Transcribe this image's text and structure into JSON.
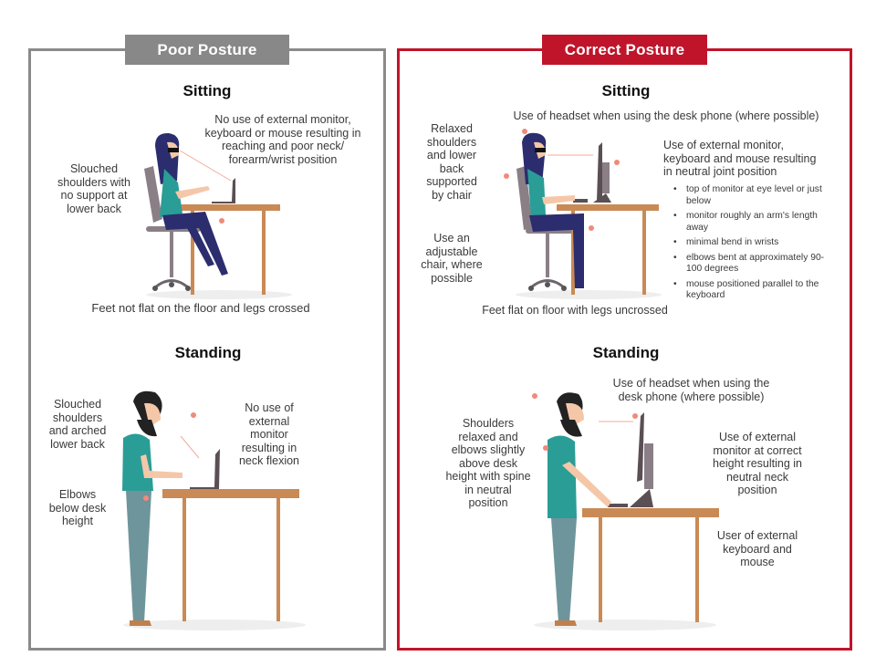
{
  "poor": {
    "badge": "Poor Posture",
    "sitting": {
      "heading": "Sitting",
      "notes": {
        "slouched": "Slouched\nshoulders with\nno support at\nlower back",
        "no_monitor": "No use of external monitor,\nkeyboard or mouse resulting in\nreaching and poor neck/\nforearm/wrist position",
        "feet": "Feet not flat on the floor and legs crossed"
      }
    },
    "standing": {
      "heading": "Standing",
      "notes": {
        "slouched": "Slouched\nshoulders\nand arched\nlower back",
        "elbows": "Elbows\nbelow desk\nheight",
        "no_monitor": "No use of\nexternal\nmonitor\nresulting in\nneck flexion"
      }
    }
  },
  "correct": {
    "badge": "Correct Posture",
    "sitting": {
      "heading": "Sitting",
      "notes": {
        "headset": "Use of headset when using the desk phone (where possible)",
        "relaxed": "Relaxed\nshoulders\nand lower\nback\nsupported\nby chair",
        "adjustable": "Use an\nadjustable\nchair, where\npossible",
        "external": "Use of external monitor,\nkeyboard and mouse resulting\nin neutral joint position",
        "feet": "Feet flat on floor with legs uncrossed"
      },
      "bullets": [
        "top of monitor at eye level or just below",
        "monitor roughly an arm's length away",
        "minimal bend in wrists",
        "elbows bent at approximately 90-100 degrees",
        "mouse positioned parallel to the keyboard"
      ]
    },
    "standing": {
      "heading": "Standing",
      "notes": {
        "headset": "Use of headset when using the\ndesk phone (where possible)",
        "shoulders": "Shoulders\nrelaxed and\nelbows slightly\nabove desk\nheight with spine\nin neutral\nposition",
        "monitor": "Use of external\nmonitor at correct\nheight resulting in\nneutral neck\nposition",
        "keyboard": "User of external\nkeyboard and\nmouse"
      }
    }
  },
  "colors": {
    "poor_accent": "#888888",
    "correct_accent": "#c0142a",
    "marker": "#f08a7a",
    "desk": "#c98a55",
    "shirt": "#2a9d96",
    "pants_sitting": "#2b2d6e",
    "pants_standing": "#6e959c"
  }
}
